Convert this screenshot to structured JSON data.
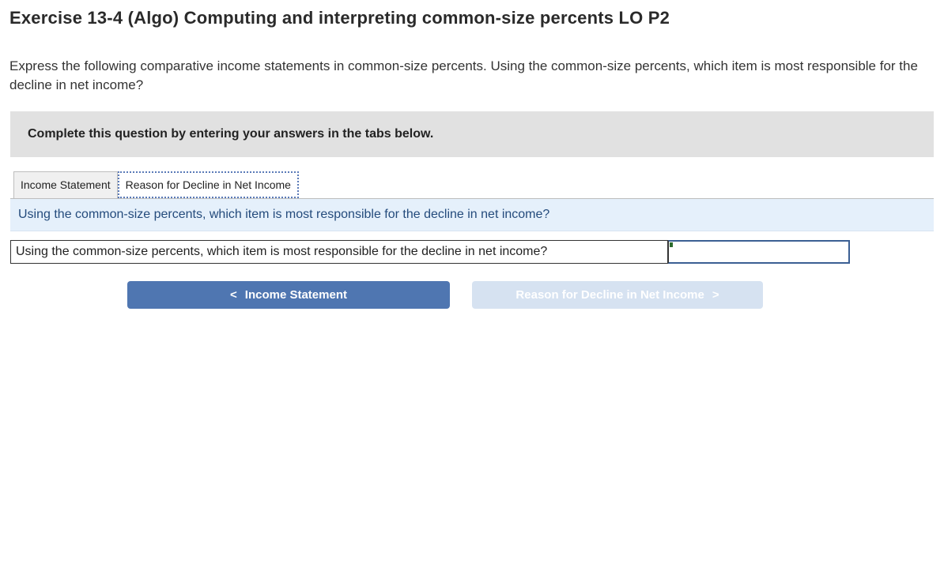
{
  "header": {
    "title": "Exercise 13-4 (Algo) Computing and interpreting common-size percents LO P2"
  },
  "question": {
    "text": "Express the following comparative income statements in common-size percents. Using the common-size percents, which item is most responsible for the decline in net income?"
  },
  "instruction": {
    "text": "Complete this question by entering your answers in the tabs below."
  },
  "tabs": [
    {
      "label": "Income Statement",
      "active": false
    },
    {
      "label": "Reason for Decline in Net Income",
      "active": true
    }
  ],
  "tab_content": {
    "header": "Using the common-size percents, which item is most responsible for the decline in net income?",
    "answer_label": "Using the common-size percents, which item is most responsible for the decline in net income?",
    "answer_value": ""
  },
  "nav": {
    "prev": {
      "label": "Income Statement",
      "chevron": "<"
    },
    "next": {
      "label": "Reason for Decline in Net Income",
      "chevron": ">"
    }
  }
}
